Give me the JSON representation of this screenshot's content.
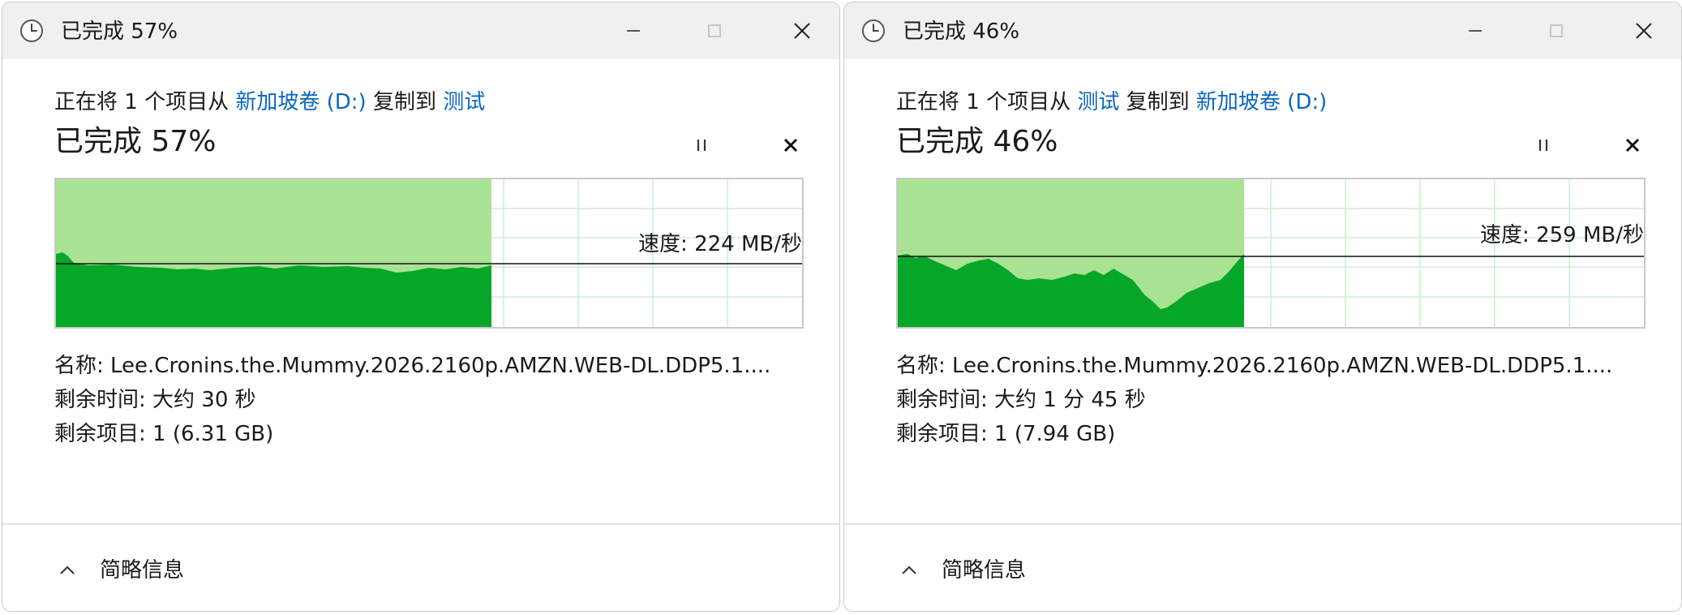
{
  "windows": [
    {
      "title": "已完成 57%",
      "desc": {
        "prefix": "正在将 1 个项目从",
        "source": "新加坡卷 (D:)",
        "middle": "复制到",
        "dest": "测试"
      },
      "heading": "已完成 57%",
      "progress_percent": 57,
      "speed": "速度: 224 MB/秒",
      "speed_level": 0.43,
      "name": "名称:  Lee.Cronins.the.Mummy.2026.2160p.AMZN.WEB-DL.DDP5.1....",
      "time_left": "剩余时间:  大约 30 秒",
      "items_left": "剩余项目:  1 (6.31 GB)",
      "footer": "简略信息"
    },
    {
      "title": "已完成 46%",
      "desc": {
        "prefix": "正在将 1 个项目从",
        "source": "测试",
        "middle": "复制到",
        "dest": "新加坡卷 (D:)"
      },
      "heading": "已完成 46%",
      "progress_percent": 46,
      "speed": "速度: 259 MB/秒",
      "speed_level": 0.48,
      "name": "名称:  Lee.Cronins.the.Mummy.2026.2160p.AMZN.WEB-DL.DDP5.1....",
      "time_left": "剩余时间:  大约 1 分 45 秒",
      "items_left": "剩余项目:  1 (7.94 GB)",
      "footer": "简略信息"
    }
  ],
  "colors": {
    "link": "#0a66c2",
    "graph_light": "#a5e08e",
    "graph_dark": "#06a628",
    "grid": "#cdeecf"
  }
}
